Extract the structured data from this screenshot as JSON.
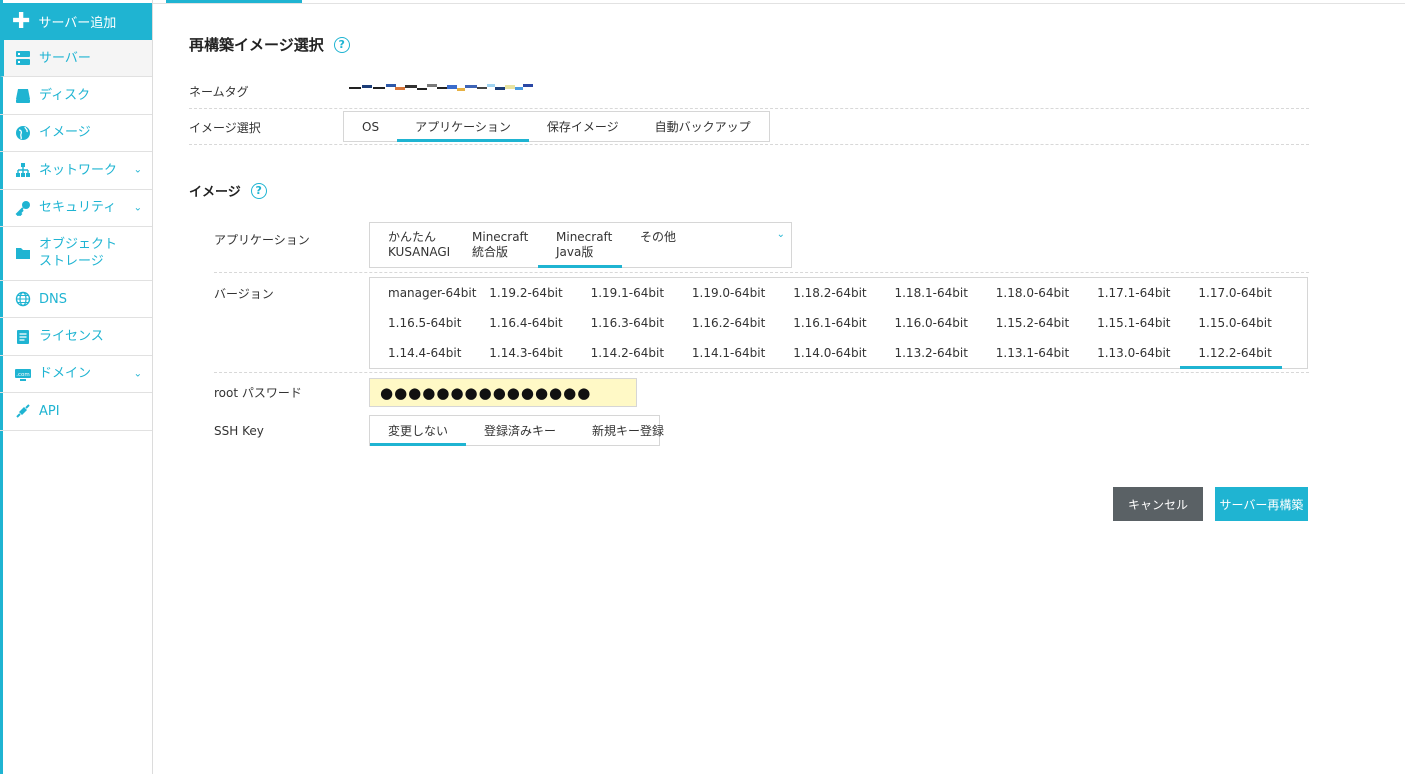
{
  "sidebar": {
    "add_server": "サーバー追加",
    "items": [
      {
        "label": "サーバー",
        "icon": "server-icon",
        "active": true
      },
      {
        "label": "ディスク",
        "icon": "disk-icon"
      },
      {
        "label": "イメージ",
        "icon": "globe-icon"
      },
      {
        "label": "ネットワーク",
        "icon": "network-icon",
        "has_submenu": true
      },
      {
        "label": "セキュリティ",
        "icon": "key-icon",
        "has_submenu": true
      },
      {
        "label": "オブジェクトストレージ",
        "icon": "folder-icon"
      },
      {
        "label": "DNS",
        "icon": "dns-globe-icon"
      },
      {
        "label": "ライセンス",
        "icon": "license-icon"
      },
      {
        "label": "ドメイン",
        "icon": "dotcom-icon",
        "has_submenu": true
      },
      {
        "label": "API",
        "icon": "api-icon"
      }
    ]
  },
  "page": {
    "title": "再構築イメージ選択",
    "help": "?"
  },
  "form": {
    "nametag_label": "ネームタグ",
    "image_select_label": "イメージ選択",
    "image_select_tabs": [
      "OS",
      "アプリケーション",
      "保存イメージ",
      "自動バックアップ"
    ],
    "image_select_selected": "アプリケーション",
    "image_section_title": "イメージ",
    "application_label": "アプリケーション",
    "applications": [
      {
        "line1": "かんたん",
        "line2": "KUSANAGI"
      },
      {
        "line1": "Minecraft",
        "line2": "統合版"
      },
      {
        "line1": "Minecraft",
        "line2": "Java版"
      },
      {
        "line1": "その他",
        "line2": ""
      }
    ],
    "application_selected": "Minecraft Java版",
    "version_label": "バージョン",
    "versions": [
      "manager-64bit",
      "1.19.2-64bit",
      "1.19.1-64bit",
      "1.19.0-64bit",
      "1.18.2-64bit",
      "1.18.1-64bit",
      "1.18.0-64bit",
      "1.17.1-64bit",
      "1.17.0-64bit",
      "1.16.5-64bit",
      "1.16.4-64bit",
      "1.16.3-64bit",
      "1.16.2-64bit",
      "1.16.1-64bit",
      "1.16.0-64bit",
      "1.15.2-64bit",
      "1.15.1-64bit",
      "1.15.0-64bit",
      "1.14.4-64bit",
      "1.14.3-64bit",
      "1.14.2-64bit",
      "1.14.1-64bit",
      "1.14.0-64bit",
      "1.13.2-64bit",
      "1.13.1-64bit",
      "1.13.0-64bit",
      "1.12.2-64bit"
    ],
    "version_selected": "1.12.2-64bit",
    "root_password_label": "root パスワード",
    "root_password_value": "●●●●●●●●●●●●●●●",
    "ssh_key_label": "SSH Key",
    "ssh_tabs": [
      "変更しない",
      "登録済みキー",
      "新規キー登録"
    ],
    "ssh_selected": "変更しない"
  },
  "buttons": {
    "cancel": "キャンセル",
    "rebuild": "サーバー再構築"
  },
  "colors": {
    "accent": "#1fb4d2",
    "cancel_bg": "#5a6165",
    "password_bg": "#fff9c6"
  }
}
